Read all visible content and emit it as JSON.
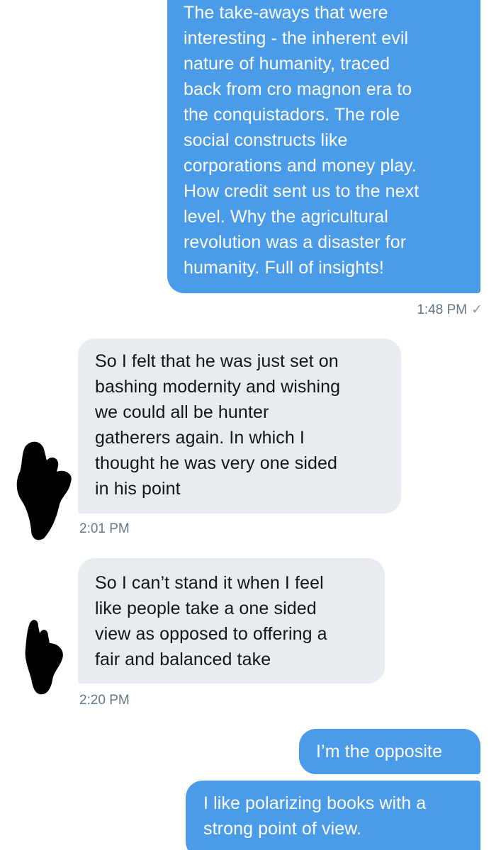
{
  "messages": [
    {
      "direction": "outgoing",
      "lines": [
        "The take-aways that were",
        "interesting - the inherent evil",
        "nature of humanity, traced",
        "back from cro magnon era to",
        "the conquistadors. The role",
        "social constructs like",
        "corporations and money play.",
        "How credit sent us to the next",
        "level. Why the agricultural",
        "revolution was a disaster for",
        "humanity. Full of insights!"
      ],
      "timestamp": "1:48 PM",
      "read_icon": "checkmark-icon"
    },
    {
      "direction": "incoming",
      "lines": [
        "So I felt that he was just set on",
        "bashing modernity and wishing",
        "we could all be hunter",
        "gatherers again.  In which I",
        "thought he was very one sided",
        "in his point"
      ],
      "timestamp": "2:01 PM"
    },
    {
      "direction": "incoming",
      "lines": [
        "So I can’t stand it when I feel",
        "like people take a one sided",
        "view as opposed to offering a",
        "fair and balanced take"
      ],
      "timestamp": "2:20 PM"
    },
    {
      "direction": "outgoing",
      "lines": [
        "I’m the opposite"
      ]
    },
    {
      "direction": "outgoing",
      "lines": [
        "I like polarizing books with a",
        "strong point of view."
      ]
    }
  ],
  "colors": {
    "outgoing_bubble": "#4a9be8",
    "incoming_bubble": "#e8ebef",
    "timestamp": "#657786",
    "redaction": "#000000"
  }
}
